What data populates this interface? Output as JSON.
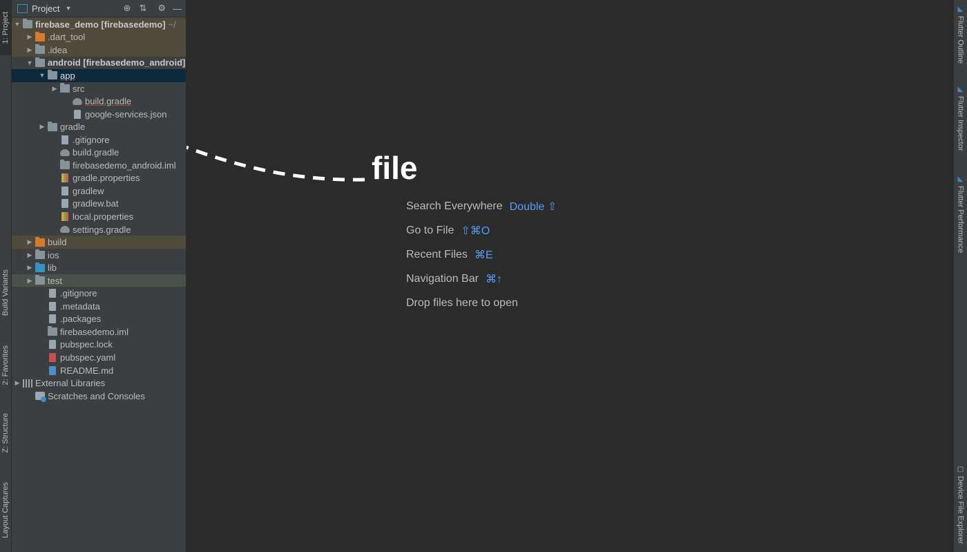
{
  "left_tabs": [
    {
      "label": "1: Project",
      "icon": "project-icon"
    },
    {
      "label": "Build Variants",
      "icon": "build-variants-icon"
    },
    {
      "label": "2: Favorites",
      "icon": "star-icon"
    },
    {
      "label": "Z: Structure",
      "icon": "structure-icon"
    },
    {
      "label": "Layout Captures",
      "icon": "layout-captures-icon"
    }
  ],
  "panel": {
    "title": "Project",
    "icons": [
      "locate-icon",
      "collapse-icon",
      "gear-icon",
      "hide-icon"
    ]
  },
  "tree": [
    {
      "label": "firebase_demo [firebasedemo]",
      "suffix": "~/",
      "indent": 0,
      "arrow": "▼",
      "icon": "folder",
      "bold": true
    },
    {
      "label": ".dart_tool",
      "indent": 1,
      "arrow": "▶",
      "icon": "folder-orange"
    },
    {
      "label": ".idea",
      "indent": 1,
      "arrow": "▶",
      "icon": "folder"
    },
    {
      "label": "android [firebasedemo_android]",
      "indent": 1,
      "arrow": "▼",
      "icon": "folder",
      "bold": true
    },
    {
      "label": "app",
      "indent": 2,
      "arrow": "▼",
      "icon": "folder",
      "underline": true
    },
    {
      "label": "src",
      "indent": 3,
      "arrow": "▶",
      "icon": "folder"
    },
    {
      "label": "build.gradle",
      "indent": 4,
      "arrow": "",
      "icon": "gradle",
      "underline": true
    },
    {
      "label": "google-services.json",
      "indent": 4,
      "arrow": "",
      "icon": "file"
    },
    {
      "label": "gradle",
      "indent": 2,
      "arrow": "▶",
      "icon": "folder"
    },
    {
      "label": ".gitignore",
      "indent": 3,
      "arrow": "",
      "icon": "file"
    },
    {
      "label": "build.gradle",
      "indent": 3,
      "arrow": "",
      "icon": "gradle"
    },
    {
      "label": "firebasedemo_android.iml",
      "indent": 3,
      "arrow": "",
      "icon": "folder"
    },
    {
      "label": "gradle.properties",
      "indent": 3,
      "arrow": "",
      "icon": "prop"
    },
    {
      "label": "gradlew",
      "indent": 3,
      "arrow": "",
      "icon": "file"
    },
    {
      "label": "gradlew.bat",
      "indent": 3,
      "arrow": "",
      "icon": "file"
    },
    {
      "label": "local.properties",
      "indent": 3,
      "arrow": "",
      "icon": "prop"
    },
    {
      "label": "settings.gradle",
      "indent": 3,
      "arrow": "",
      "icon": "gradle"
    },
    {
      "label": "build",
      "indent": 1,
      "arrow": "▶",
      "icon": "folder-orange"
    },
    {
      "label": "ios",
      "indent": 1,
      "arrow": "▶",
      "icon": "folder"
    },
    {
      "label": "lib",
      "indent": 1,
      "arrow": "▶",
      "icon": "folder-blue"
    },
    {
      "label": "test",
      "indent": 1,
      "arrow": "▶",
      "icon": "folder"
    },
    {
      "label": ".gitignore",
      "indent": 2,
      "arrow": "",
      "icon": "file"
    },
    {
      "label": ".metadata",
      "indent": 2,
      "arrow": "",
      "icon": "file"
    },
    {
      "label": ".packages",
      "indent": 2,
      "arrow": "",
      "icon": "file"
    },
    {
      "label": "firebasedemo.iml",
      "indent": 2,
      "arrow": "",
      "icon": "folder"
    },
    {
      "label": "pubspec.lock",
      "indent": 2,
      "arrow": "",
      "icon": "file"
    },
    {
      "label": "pubspec.yaml",
      "indent": 2,
      "arrow": "",
      "icon": "yml"
    },
    {
      "label": "README.md",
      "indent": 2,
      "arrow": "",
      "icon": "md"
    },
    {
      "label": "External Libraries",
      "indent": 0,
      "arrow": "▶",
      "icon": "lib"
    },
    {
      "label": "Scratches and Consoles",
      "indent": 1,
      "arrow": "",
      "icon": "scratch"
    }
  ],
  "annotation": "file",
  "hints": [
    {
      "label": "Search Everywhere",
      "shortcut": "Double ⇧"
    },
    {
      "label": "Go to File",
      "shortcut": "⇧⌘O"
    },
    {
      "label": "Recent Files",
      "shortcut": "⌘E"
    },
    {
      "label": "Navigation Bar",
      "shortcut": "⌘↑"
    },
    {
      "label": "Drop files here to open",
      "shortcut": ""
    }
  ],
  "right_tabs": [
    {
      "label": "Flutter Outline",
      "icon": "flutter-icon"
    },
    {
      "label": "Flutter Inspector",
      "icon": "flutter-icon"
    },
    {
      "label": "Flutter Performance",
      "icon": "flutter-icon"
    },
    {
      "label": "Device File Explorer",
      "icon": "device-icon"
    }
  ]
}
